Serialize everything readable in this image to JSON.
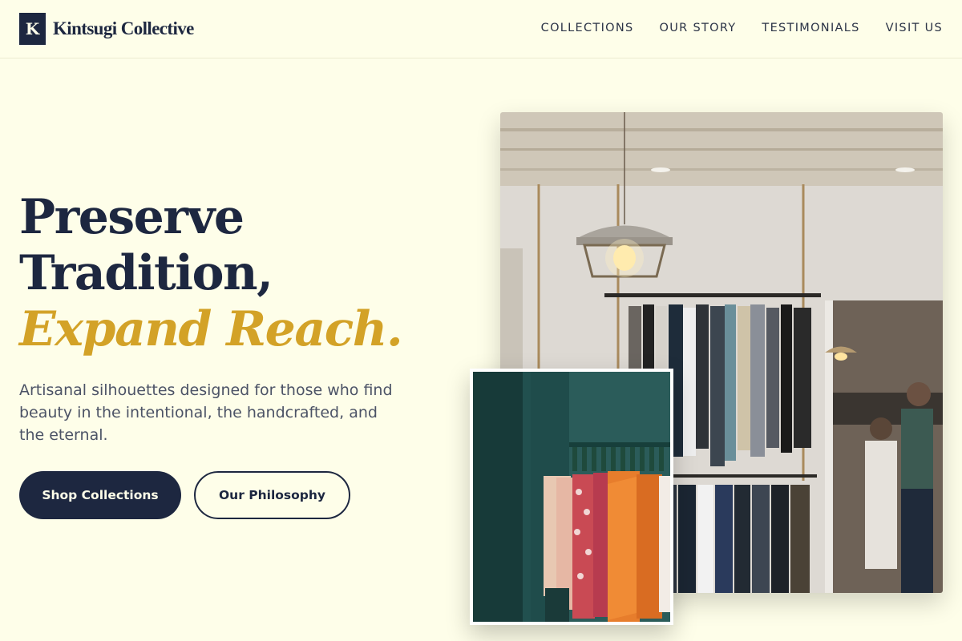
{
  "brand": {
    "mark": "K",
    "name": "Kintsugi Collective"
  },
  "nav": {
    "items": [
      {
        "label": "COLLECTIONS"
      },
      {
        "label": "OUR STORY"
      },
      {
        "label": "TESTIMONIALS"
      },
      {
        "label": "VISIT US"
      }
    ]
  },
  "hero": {
    "line1": "Preserve",
    "line2": "Tradition,",
    "line3": "Expand Reach.",
    "subtitle": "Artisanal silhouettes designed for those who find beauty in the intentional, the handcrafted, and the eternal.",
    "primary_cta": "Shop Collections",
    "secondary_cta": "Our Philosophy"
  },
  "colors": {
    "background": "#fefee9",
    "navy": "#1d2740",
    "gold": "#d3a227",
    "body_text": "#4c5366"
  }
}
